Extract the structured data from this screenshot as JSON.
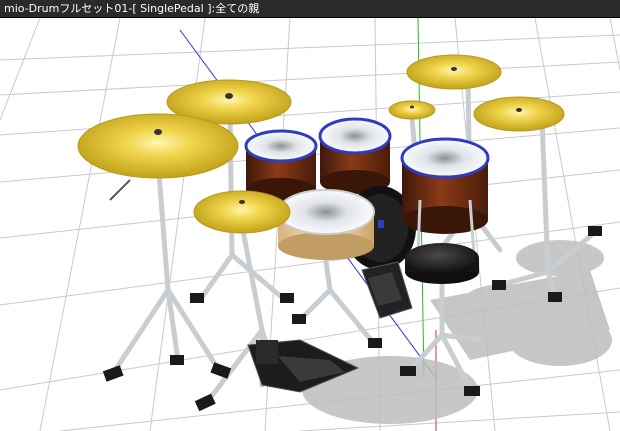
{
  "window": {
    "title": "mio-Drumフルセット01-[ SinglePedal ]:全ての親"
  },
  "viewport": {
    "grid": true,
    "axis_colors": {
      "x": "#e03030",
      "y": "#20c020",
      "z": "#3030e0"
    },
    "cymbal_color": "#e7c531",
    "drum_shell_color": "#6b2d14",
    "drum_rim_color": "#2d3cc0",
    "stand_color": "#c8cdd2",
    "seat_color": "#1d1d1d"
  },
  "objects": {
    "cymbals": [
      "crash-cymbal-left",
      "ride-cymbal-back-left",
      "crash-cymbal-back-right",
      "splash-cymbal",
      "china-cymbal-right",
      "hihat-cymbal"
    ],
    "drums": [
      "snare-drum",
      "tom-left",
      "tom-center",
      "floor-tom",
      "bass-drum"
    ],
    "hardware": [
      "throne",
      "kick-pedal",
      "hihat-pedal"
    ]
  }
}
